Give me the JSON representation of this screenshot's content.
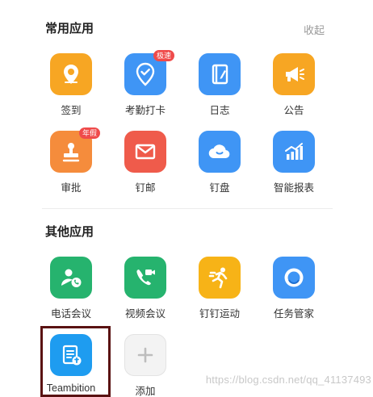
{
  "common_apps": {
    "title": "常用应用",
    "collapse_label": "收起",
    "items": [
      {
        "label": "签到",
        "icon": "location-pin-icon",
        "color": "#f7a623"
      },
      {
        "label": "考勤打卡",
        "icon": "check-pin-icon",
        "color": "#3f95f5",
        "badge": "极速"
      },
      {
        "label": "日志",
        "icon": "journal-icon",
        "color": "#3f95f5"
      },
      {
        "label": "公告",
        "icon": "megaphone-icon",
        "color": "#f7a623"
      },
      {
        "label": "审批",
        "icon": "stamp-icon",
        "color": "#f58c3c",
        "badge": "年假"
      },
      {
        "label": "钉邮",
        "icon": "mail-icon",
        "color": "#ef5b4b"
      },
      {
        "label": "钉盘",
        "icon": "cloud-icon",
        "color": "#3f95f5"
      },
      {
        "label": "智能报表",
        "icon": "bar-chart-icon",
        "color": "#3f95f5"
      }
    ]
  },
  "other_apps": {
    "title": "其他应用",
    "items": [
      {
        "label": "电话会议",
        "icon": "phone-user-icon",
        "color": "#26b36e"
      },
      {
        "label": "视频会议",
        "icon": "video-call-icon",
        "color": "#26b36e"
      },
      {
        "label": "钉钉运动",
        "icon": "runner-icon",
        "color": "#f7b317"
      },
      {
        "label": "任务管家",
        "icon": "ring-icon",
        "color": "#3f95f5"
      },
      {
        "label": "Teambition",
        "icon": "teambition-icon",
        "color": "#1e9cf0"
      },
      {
        "label": "添加",
        "icon": "plus-icon",
        "color": "#f3f3f3"
      }
    ]
  },
  "watermark": "https://blog.csdn.net/qq_41137493"
}
